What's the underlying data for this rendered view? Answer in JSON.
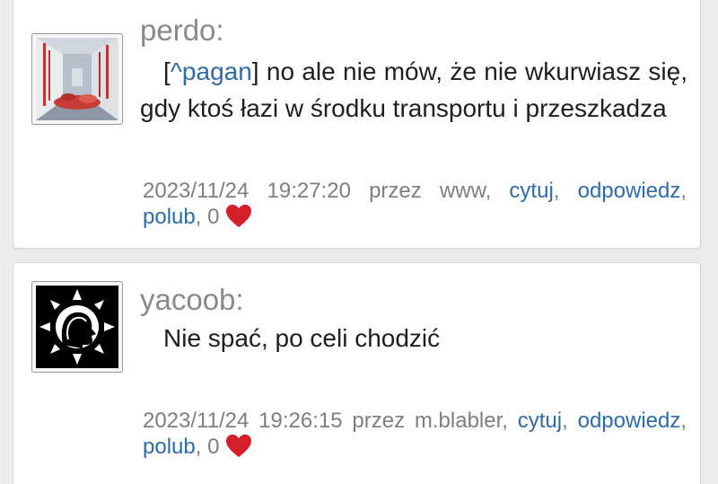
{
  "comments": [
    {
      "author": "perdo:",
      "avatar_icon": "photo-avatar-icon",
      "quote_open": "[",
      "quote_ref": "^pagan",
      "quote_close": "]",
      "text": " no ale nie mów, że nie wkurwiasz się, gdy ktoś łazi w środku transportu i przeszkadza",
      "date": "2023/11/24",
      "time": "19:27:20",
      "by_label": "przez",
      "by_user": "www,",
      "cite_label": "cytuj",
      "reply_label": "odpowiedz",
      "like_label": "polub",
      "likes": "0"
    },
    {
      "author": "yacoob:",
      "avatar_icon": "head-sun-avatar-icon",
      "text": "Nie spać, po celi chodzić",
      "date": "2023/11/24",
      "time": "19:26:15",
      "by_label": "przez",
      "by_user": "m.blabler,",
      "cite_label": "cytuj",
      "reply_label": "odpowiedz",
      "like_label": "polub",
      "likes": "0"
    }
  ],
  "colors": {
    "link": "#2d6ca8",
    "heart": "#d4202a",
    "author": "#8a8a8a",
    "meta": "#7e7e7e"
  }
}
